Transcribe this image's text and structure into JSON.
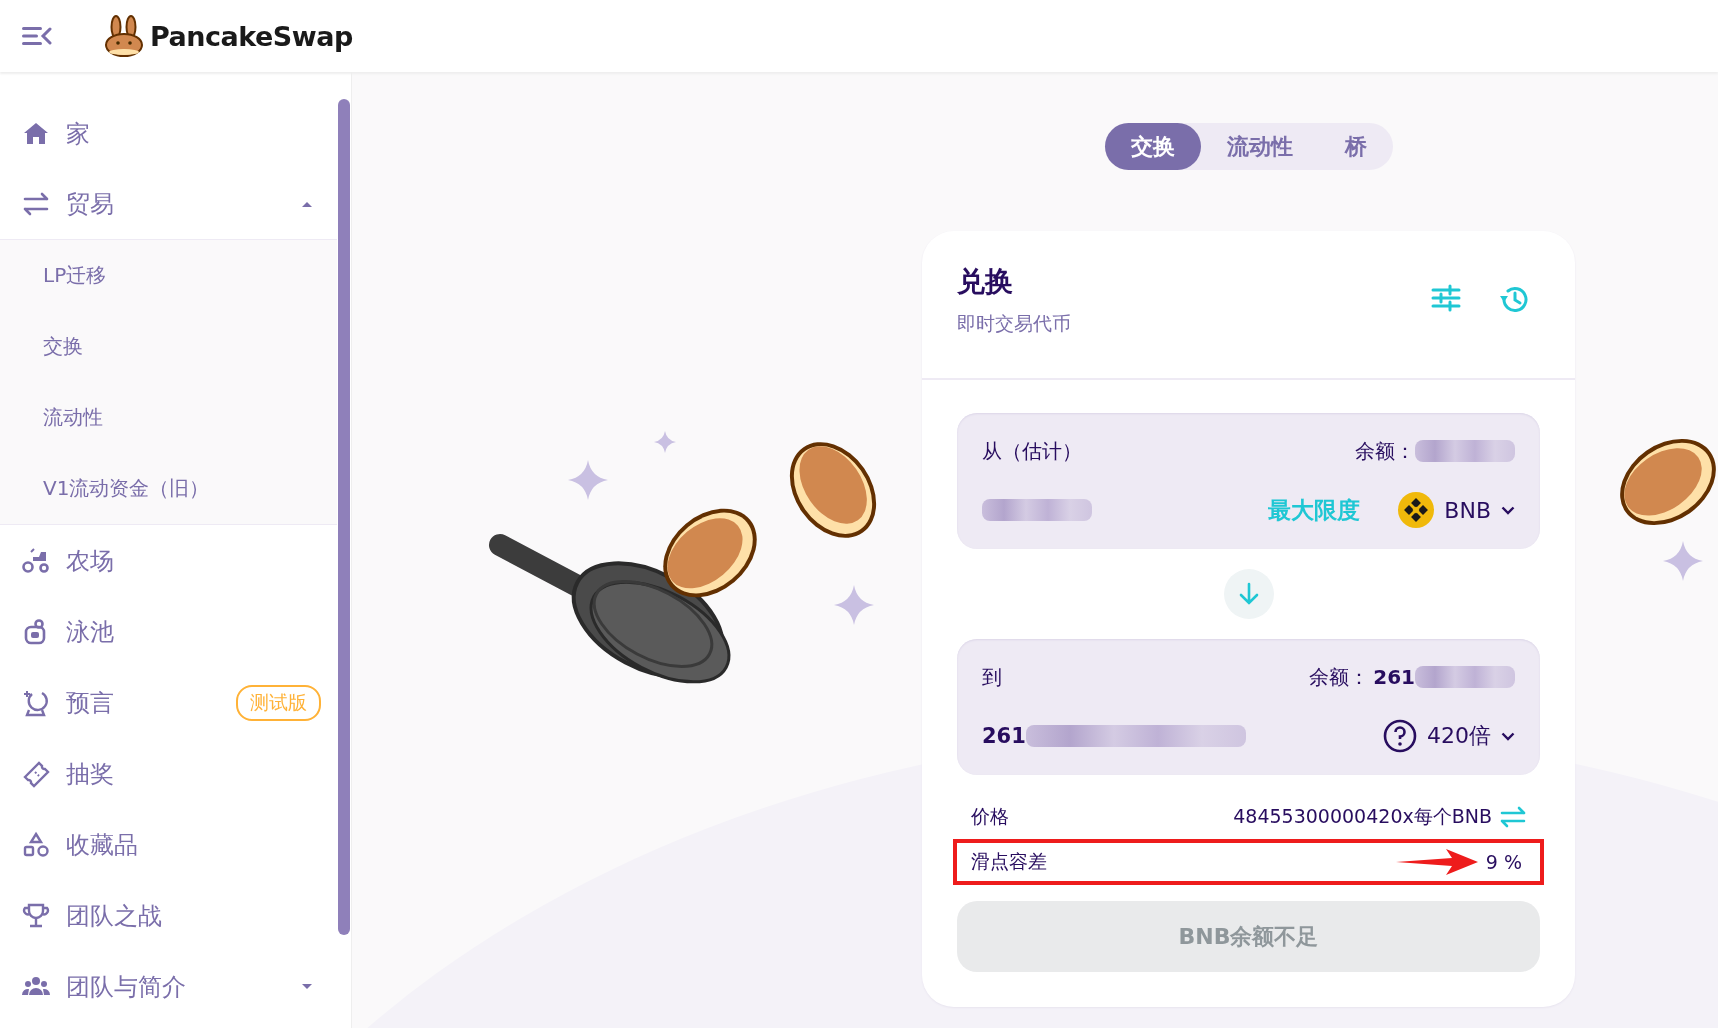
{
  "header": {
    "logo_text": "PancakeSwap"
  },
  "sidebar": {
    "items": [
      {
        "label": "家"
      },
      {
        "label": "贸易",
        "expanded": true,
        "children": [
          {
            "label": "LP迁移"
          },
          {
            "label": "交换"
          },
          {
            "label": "流动性"
          },
          {
            "label": "V1流动资金（旧）"
          }
        ]
      },
      {
        "label": "农场"
      },
      {
        "label": "泳池"
      },
      {
        "label": "预言",
        "badge": "测试版"
      },
      {
        "label": "抽奖"
      },
      {
        "label": "收藏品"
      },
      {
        "label": "团队之战"
      },
      {
        "label": "团队与简介",
        "expanded": false
      }
    ]
  },
  "tabs": [
    {
      "label": "交换",
      "selected": true
    },
    {
      "label": "流动性",
      "selected": false
    },
    {
      "label": "桥",
      "selected": false
    }
  ],
  "swap_card": {
    "title": "兑换",
    "subtitle": "即时交易代币",
    "from": {
      "label": "从（估计）",
      "balance_label": "余额：",
      "max_label": "最大限度",
      "token": "BNB"
    },
    "to": {
      "label": "到",
      "balance_label": "余额：",
      "balance_prefix": "261",
      "amount_prefix": "261",
      "token": "420倍"
    },
    "details": [
      {
        "kind": "price",
        "label": "价格",
        "value": "48455300000420x每个BNB",
        "highlighted": false
      },
      {
        "kind": "slippage",
        "label": "滑点容差",
        "value": "9 %",
        "highlighted": true
      }
    ],
    "submit": {
      "label": "BNB余额不足",
      "disabled": true
    }
  }
}
